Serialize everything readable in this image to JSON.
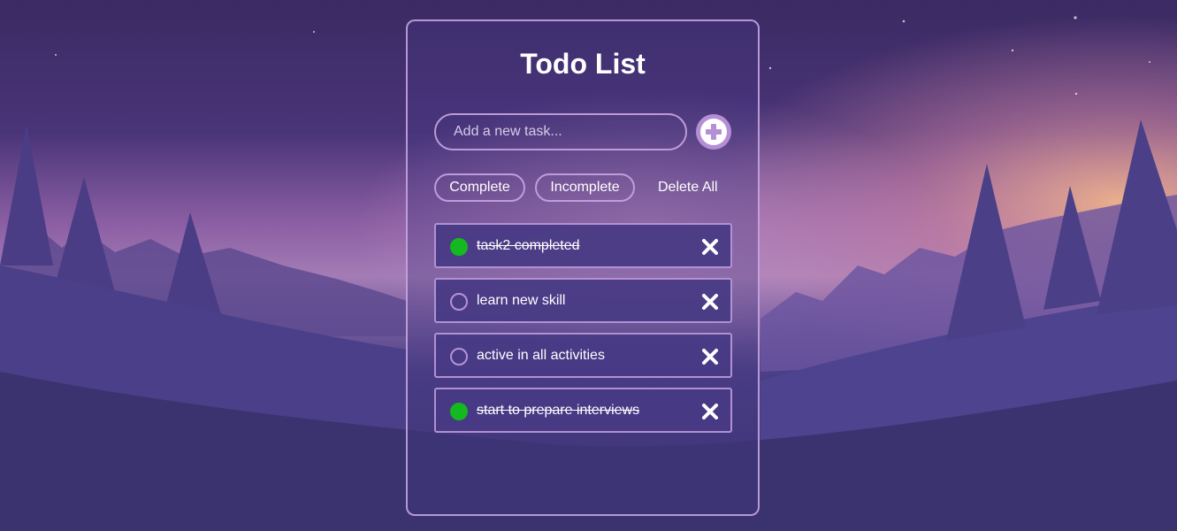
{
  "app": {
    "title": "Todo List"
  },
  "input": {
    "placeholder": "Add a new task...",
    "value": ""
  },
  "filters": {
    "complete_label": "Complete",
    "incomplete_label": "Incomplete",
    "delete_all_label": "Delete All"
  },
  "todos": [
    {
      "text": "task2 completed",
      "completed": true
    },
    {
      "text": "learn new skill",
      "completed": false
    },
    {
      "text": "active in all activities",
      "completed": false
    },
    {
      "text": "start to prepare interviews",
      "completed": true
    }
  ],
  "colors": {
    "accent": "#b58fd6",
    "done": "#14b820",
    "border": "#c8a5e1"
  },
  "icons": {
    "add": "plus-circle-icon",
    "delete": "x-icon",
    "status_done": "filled-circle-icon",
    "status_open": "empty-circle-icon"
  }
}
